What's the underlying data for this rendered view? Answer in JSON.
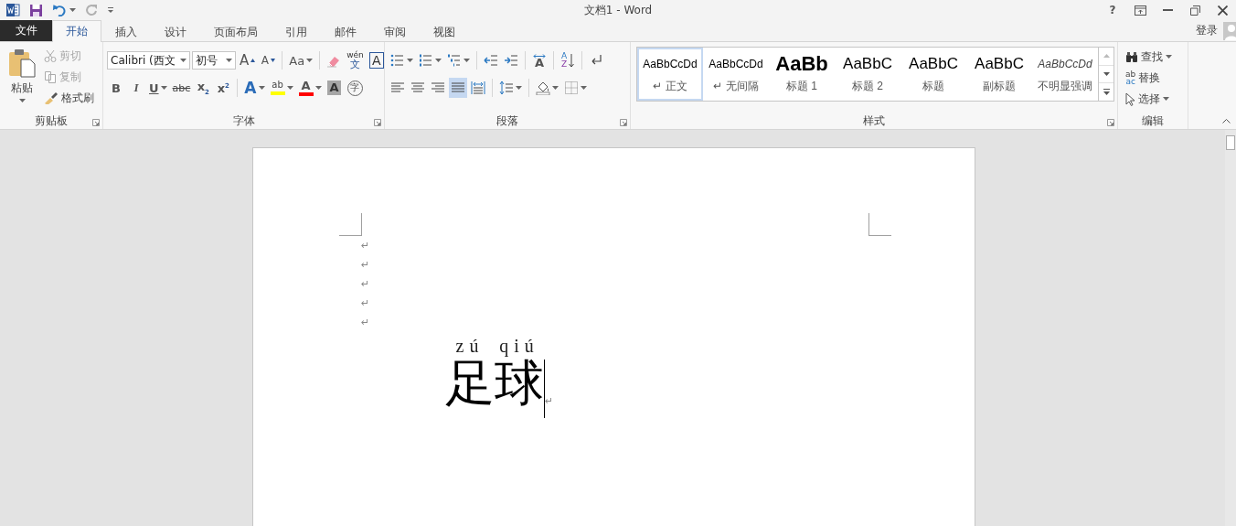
{
  "window": {
    "title": "文档1 - Word",
    "help": "?"
  },
  "tabs": [
    {
      "label": "文件",
      "kind": "file",
      "selected": false
    },
    {
      "label": "开始",
      "kind": "tab",
      "selected": true
    },
    {
      "label": "插入",
      "kind": "tab",
      "selected": false
    },
    {
      "label": "设计",
      "kind": "tab",
      "selected": false
    },
    {
      "label": "页面布局",
      "kind": "tab",
      "selected": false
    },
    {
      "label": "引用",
      "kind": "tab",
      "selected": false
    },
    {
      "label": "邮件",
      "kind": "tab",
      "selected": false
    },
    {
      "label": "审阅",
      "kind": "tab",
      "selected": false
    },
    {
      "label": "视图",
      "kind": "tab",
      "selected": false
    }
  ],
  "account": {
    "label": "登录"
  },
  "clipboard": {
    "group": "剪贴板",
    "paste": "粘贴",
    "items": [
      {
        "kind": "cut",
        "label": "剪切",
        "disabled": true
      },
      {
        "kind": "copy",
        "label": "复制",
        "disabled": true
      },
      {
        "kind": "painter",
        "label": "格式刷",
        "disabled": false
      }
    ]
  },
  "font": {
    "group": "字体",
    "name": "Calibri (西文",
    "size": "初号",
    "row1": [
      {
        "kind": "grow",
        "text": "A"
      },
      {
        "kind": "shrink",
        "text": "A"
      },
      {
        "kind": "case",
        "text": "Aa"
      },
      {
        "kind": "clear"
      },
      {
        "kind": "phonetic",
        "text": "wén",
        "sub": "文"
      },
      {
        "kind": "border",
        "text": "A"
      }
    ],
    "row2": [
      {
        "kind": "bold",
        "text": "B"
      },
      {
        "kind": "italic",
        "text": "I"
      },
      {
        "kind": "underline",
        "text": "U"
      },
      {
        "kind": "strike",
        "text": "abc"
      },
      {
        "kind": "subscript",
        "text": "x",
        "sub": "2"
      },
      {
        "kind": "superscript",
        "text": "x",
        "sub": "2"
      },
      {
        "kind": "effect",
        "text": "A"
      },
      {
        "kind": "highlight",
        "text": "ab",
        "color": "#ffff00"
      },
      {
        "kind": "fontcolor",
        "text": "A",
        "color": "#ff0000"
      },
      {
        "kind": "shade",
        "text": "A"
      },
      {
        "kind": "enclose",
        "text": "字"
      }
    ]
  },
  "paragraph": {
    "group": "段落",
    "row1": [
      {
        "kind": "bullets"
      },
      {
        "kind": "numbering"
      },
      {
        "kind": "multilevel"
      },
      {
        "kind": "outdent"
      },
      {
        "kind": "indent"
      },
      {
        "kind": "asian",
        "text": "A"
      },
      {
        "kind": "sort",
        "text": "A",
        "sub": "Z"
      },
      {
        "kind": "marks"
      }
    ],
    "row2": [
      {
        "kind": "left",
        "selected": false
      },
      {
        "kind": "center",
        "selected": false
      },
      {
        "kind": "right",
        "selected": false
      },
      {
        "kind": "justify",
        "selected": true
      },
      {
        "kind": "distribute",
        "selected": false
      },
      {
        "kind": "spacing",
        "selected": false
      },
      {
        "kind": "shading",
        "selected": false
      },
      {
        "kind": "borders",
        "selected": false
      }
    ]
  },
  "styles": {
    "group": "样式",
    "items": [
      {
        "kind": "normal",
        "preview": "AaBbCcDd",
        "label": "↵ 正文",
        "selected": true
      },
      {
        "kind": "normal",
        "preview": "AaBbCcDd",
        "label": "↵ 无间隔",
        "selected": false
      },
      {
        "kind": "heading1",
        "preview": "AaBb",
        "label": "标题 1",
        "selected": false
      },
      {
        "kind": "heading",
        "preview": "AaBbC",
        "label": "标题 2",
        "selected": false
      },
      {
        "kind": "heading",
        "preview": "AaBbC",
        "label": "标题",
        "selected": false
      },
      {
        "kind": "heading",
        "preview": "AaBbC",
        "label": "副标题",
        "selected": false
      },
      {
        "kind": "emphasis",
        "preview": "AaBbCcDd",
        "label": "不明显强调",
        "selected": false
      }
    ]
  },
  "editing": {
    "group": "编辑",
    "items": [
      {
        "kind": "find",
        "label": "查找"
      },
      {
        "kind": "replace",
        "label": "替换",
        "text": "ab",
        "sub": "ac"
      },
      {
        "kind": "select",
        "label": "选择"
      }
    ]
  },
  "document": {
    "paragraph_marks": [
      "↵",
      "↵",
      "↵",
      "↵",
      "↵"
    ],
    "ruby": [
      {
        "base": "足",
        "ruby": "zú"
      },
      {
        "base": "球",
        "ruby": "qiú"
      }
    ],
    "end_mark": "↵"
  }
}
